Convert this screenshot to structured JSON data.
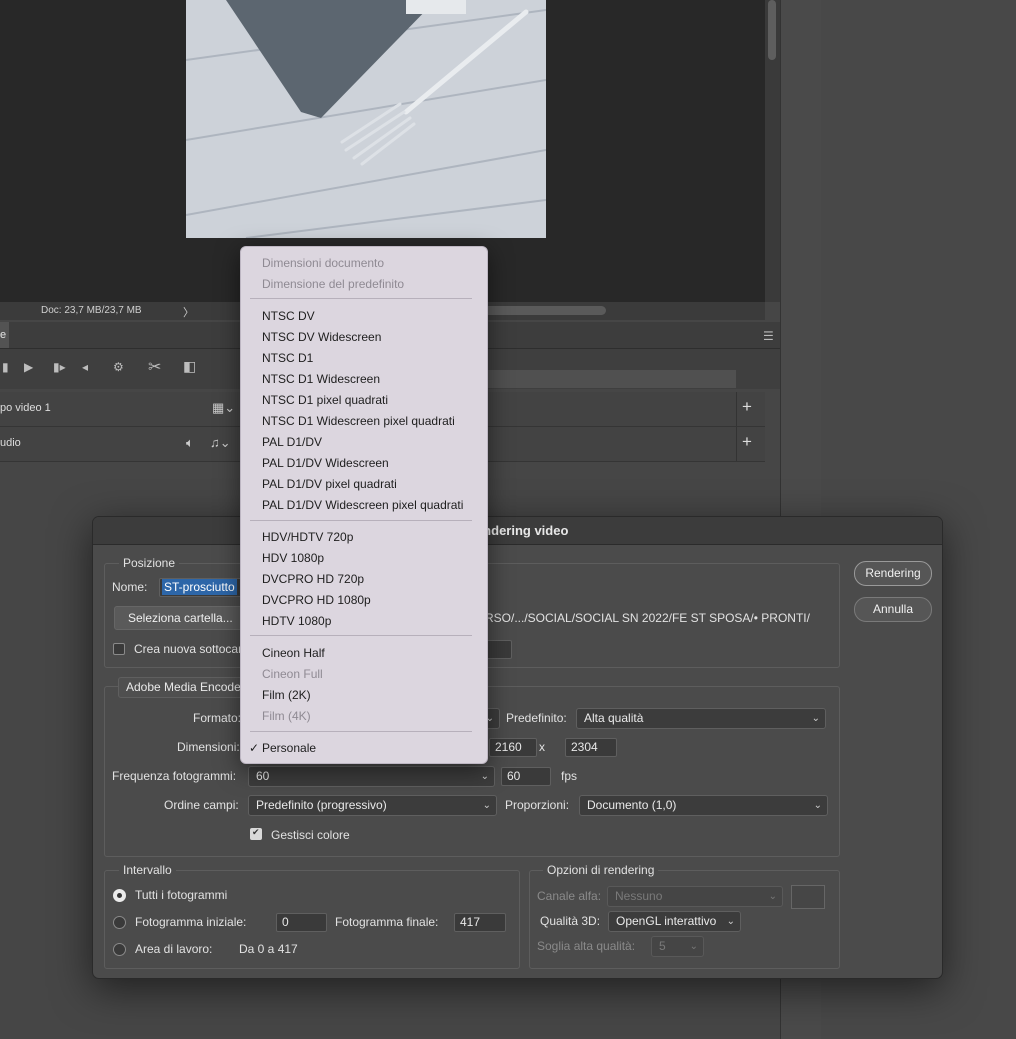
{
  "workspace": {
    "status_doc": "Doc: 23,7 MB/23,7 MB",
    "status_arrow": "〉",
    "tracks": [
      {
        "label": "po video 1"
      },
      {
        "label": "udio"
      }
    ]
  },
  "dialog": {
    "title": "Rendering video",
    "buttons": {
      "render": "Rendering",
      "cancel": "Annulla"
    },
    "posizione": {
      "title": "Posizione",
      "name_label": "Nome:",
      "name_value": "ST-prosciutto",
      "select_folder": "Seleziona cartella...",
      "folder_path": "RSO/.../SOCIAL/SOCIAL SN 2022/FE ST SPOSA/• PRONTI/",
      "subfolder_label": "Crea nuova sottocartella:"
    },
    "encoder": {
      "selected": "Adobe Media Encoder",
      "format_label": "Formato:",
      "preset_label": "Predefinito:",
      "preset_value": "Alta qualità",
      "size_label": "Dimensioni:",
      "width": "2160",
      "size_x": "x",
      "height": "2304",
      "fps_label": "Frequenza fotogrammi:",
      "fps_select": "60",
      "fps_value": "60",
      "fps_unit": "fps",
      "field_order_label": "Ordine campi:",
      "field_order_value": "Predefinito (progressivo)",
      "aspect_label": "Proporzioni:",
      "aspect_value": "Documento (1,0)",
      "color_manage_label": "Gestisci colore",
      "color_manage_checked": true
    },
    "range": {
      "title": "Intervallo",
      "all_frames": "Tutti i fotogrammi",
      "start_frame_label": "Fotogramma iniziale:",
      "start_frame_value": "0",
      "end_frame_label": "Fotogramma finale:",
      "end_frame_value": "417",
      "work_area_label": "Area di lavoro:",
      "work_area_value": "Da 0 a 417"
    },
    "render_options": {
      "title": "Opzioni di rendering",
      "alpha_label": "Canale alfa:",
      "alpha_value": "Nessuno",
      "quality3d_label": "Qualità 3D:",
      "quality3d_value": "OpenGL interattivo",
      "hq_threshold_label": "Soglia alta qualità:",
      "hq_threshold_value": "5"
    }
  },
  "dropdown": {
    "groups": [
      [
        {
          "label": "Dimensioni documento",
          "enabled": false
        },
        {
          "label": "Dimensione del predefinito",
          "enabled": false
        }
      ],
      [
        {
          "label": "NTSC DV",
          "enabled": true
        },
        {
          "label": "NTSC DV Widescreen",
          "enabled": true
        },
        {
          "label": "NTSC D1",
          "enabled": true
        },
        {
          "label": "NTSC D1 Widescreen",
          "enabled": true
        },
        {
          "label": "NTSC D1 pixel quadrati",
          "enabled": true
        },
        {
          "label": "NTSC D1 Widescreen pixel quadrati",
          "enabled": true
        },
        {
          "label": "PAL D1/DV",
          "enabled": true
        },
        {
          "label": "PAL D1/DV Widescreen",
          "enabled": true
        },
        {
          "label": "PAL D1/DV pixel quadrati",
          "enabled": true
        },
        {
          "label": "PAL D1/DV Widescreen pixel quadrati",
          "enabled": true
        }
      ],
      [
        {
          "label": "HDV/HDTV 720p",
          "enabled": true
        },
        {
          "label": "HDV 1080p",
          "enabled": true
        },
        {
          "label": "DVCPRO HD 720p",
          "enabled": true
        },
        {
          "label": "DVCPRO HD 1080p",
          "enabled": true
        },
        {
          "label": "HDTV 1080p",
          "enabled": true
        }
      ],
      [
        {
          "label": "Cineon Half",
          "enabled": true
        },
        {
          "label": "Cineon Full",
          "enabled": false
        },
        {
          "label": "Film (2K)",
          "enabled": true
        },
        {
          "label": "Film (4K)",
          "enabled": false
        }
      ],
      [
        {
          "label": "Personale",
          "enabled": true,
          "checked": true
        }
      ]
    ]
  }
}
